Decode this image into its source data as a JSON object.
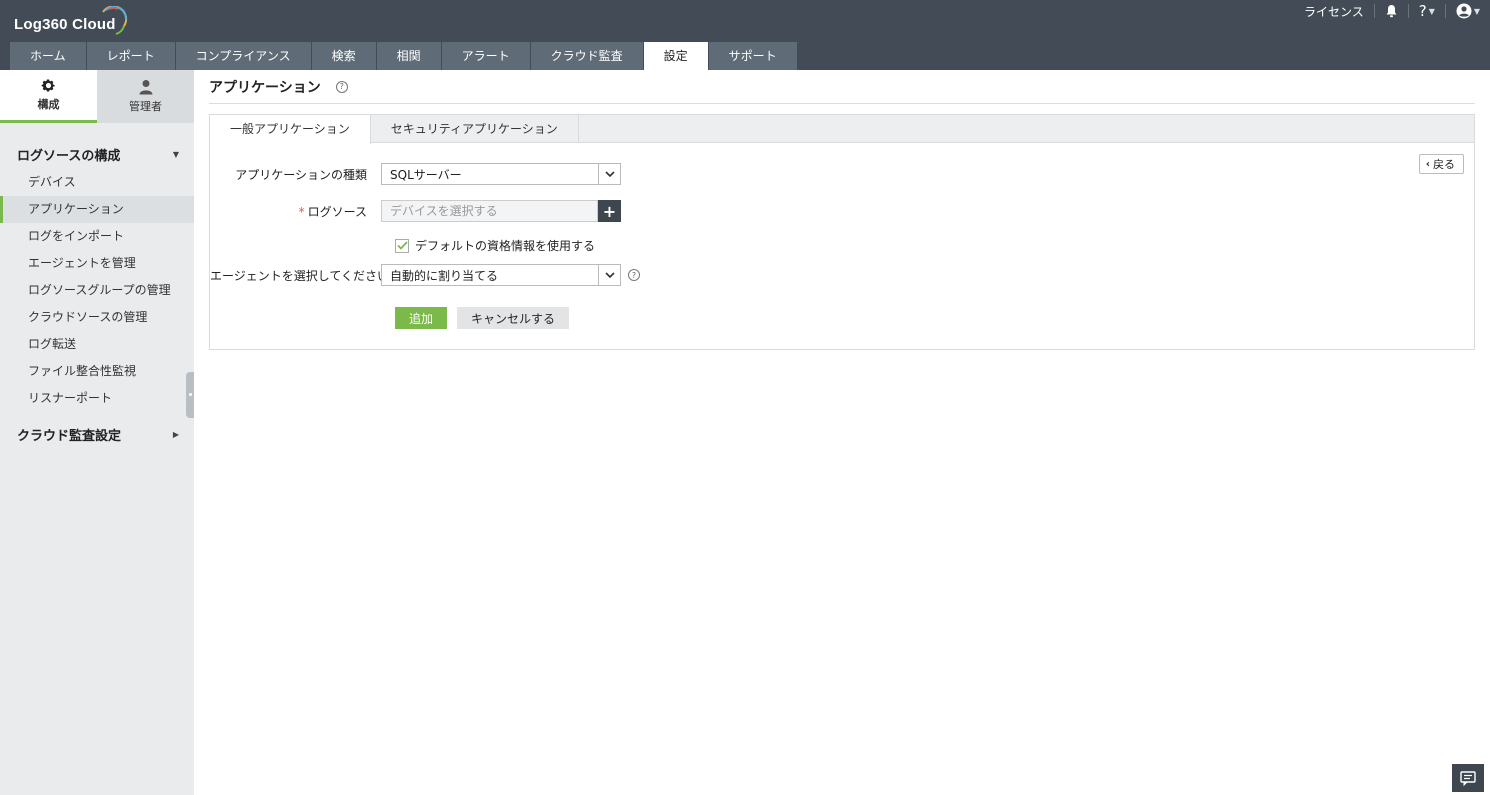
{
  "header": {
    "logo_text": "Log360 Cloud",
    "license_label": "ライセンス",
    "help_label": "?",
    "nav_tabs": [
      {
        "label": "ホーム"
      },
      {
        "label": "レポート"
      },
      {
        "label": "コンプライアンス"
      },
      {
        "label": "検索"
      },
      {
        "label": "相関"
      },
      {
        "label": "アラート"
      },
      {
        "label": "クラウド監査"
      },
      {
        "label": "設定",
        "active": true
      },
      {
        "label": "サポート"
      }
    ]
  },
  "sidebar": {
    "tabs": [
      {
        "label": "構成",
        "icon": "gear-icon",
        "active": true
      },
      {
        "label": "管理者",
        "icon": "user-icon"
      }
    ],
    "group1_title": "ログソースの構成",
    "items": [
      {
        "label": "デバイス"
      },
      {
        "label": "アプリケーション",
        "active": true
      },
      {
        "label": "ログをインポート"
      },
      {
        "label": "エージェントを管理"
      },
      {
        "label": "ログソースグループの管理"
      },
      {
        "label": "クラウドソースの管理"
      },
      {
        "label": "ログ転送"
      },
      {
        "label": "ファイル整合性監視"
      },
      {
        "label": "リスナーポート"
      }
    ],
    "group2_title": "クラウド監査設定"
  },
  "main": {
    "title": "アプリケーション",
    "tabs": [
      {
        "label": "一般アプリケーション",
        "active": true
      },
      {
        "label": "セキュリティアプリケーション"
      }
    ],
    "back_label": "戻る",
    "form": {
      "app_type_label": "アプリケーションの種類",
      "app_type_value": "SQLサーバー",
      "required_mark": "*",
      "log_source_label": "ログソース",
      "log_source_placeholder": "デバイスを選択する",
      "default_credentials_label": "デフォルトの資格情報を使用する",
      "default_credentials_checked": true,
      "agent_label": "エージェントを選択してください",
      "agent_value": "自動的に割り当てる",
      "add_button": "追加",
      "cancel_button": "キャンセルする"
    }
  },
  "colors": {
    "header_bg": "#434c56",
    "nav_tab_bg": "#5f6b76",
    "accent_green": "#7bb94a",
    "sidebar_bg": "#e9ebed",
    "dark_button": "#3e4750"
  }
}
